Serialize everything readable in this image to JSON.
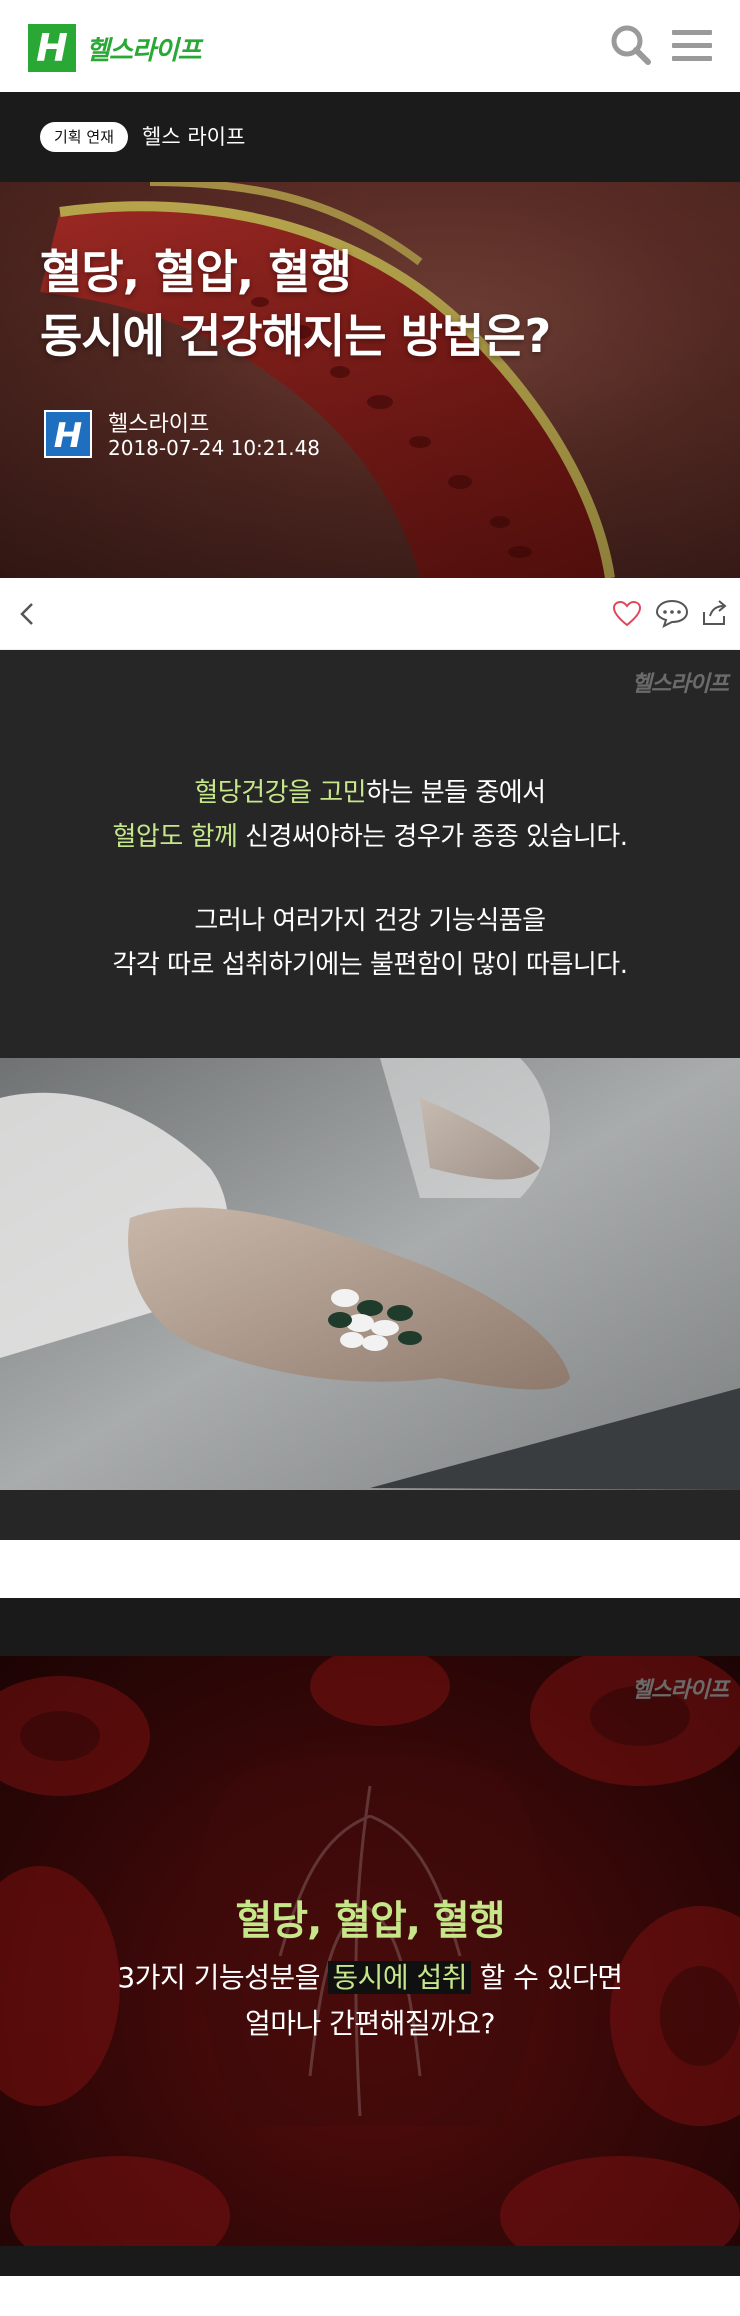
{
  "header": {
    "logo_letter": "H",
    "logo_text": "헬스라이프",
    "brand_color": "#2aa836",
    "search_icon": "search-icon",
    "menu_icon": "hamburger-menu-icon"
  },
  "category": {
    "badge": "기획 연재",
    "name": "헬스 라이프"
  },
  "article": {
    "title_line1": "혈당, 혈압, 혈행",
    "title_line2": "동시에 건강해지는 방법은?",
    "author_letter": "H",
    "author": "헬스라이프",
    "date": "2018-07-24  10:21.48"
  },
  "actions": {
    "back_icon": "chevron-left-icon",
    "like_icon": "heart-icon",
    "comment_icon": "speech-bubble-icon",
    "share_icon": "share-icon",
    "like_color": "#e0475b"
  },
  "card1": {
    "watermark": "헬스라이프",
    "line1_hl": "혈당건강을 고민",
    "line1_rest": "하는 분들 중에서",
    "line2_hl": "혈압도 함께",
    "line2_rest": " 신경써야하는 경우가 종종 있습니다.",
    "line3": "그러나 여러가지 건강 기능식품을",
    "line4": "각각 따로 섭취하기에는 불편함이 많이 따릅니다.",
    "highlight_color": "#c6e68a"
  },
  "card2": {
    "watermark": "헬스라이프",
    "title": "혈당, 혈압, 혈행",
    "line1_a": "3가지 기능성분을 ",
    "line1_hl": "동시에 섭취",
    "line1_b": " 할 수 있다면",
    "line2": "얼마나 간편해질까요?"
  }
}
